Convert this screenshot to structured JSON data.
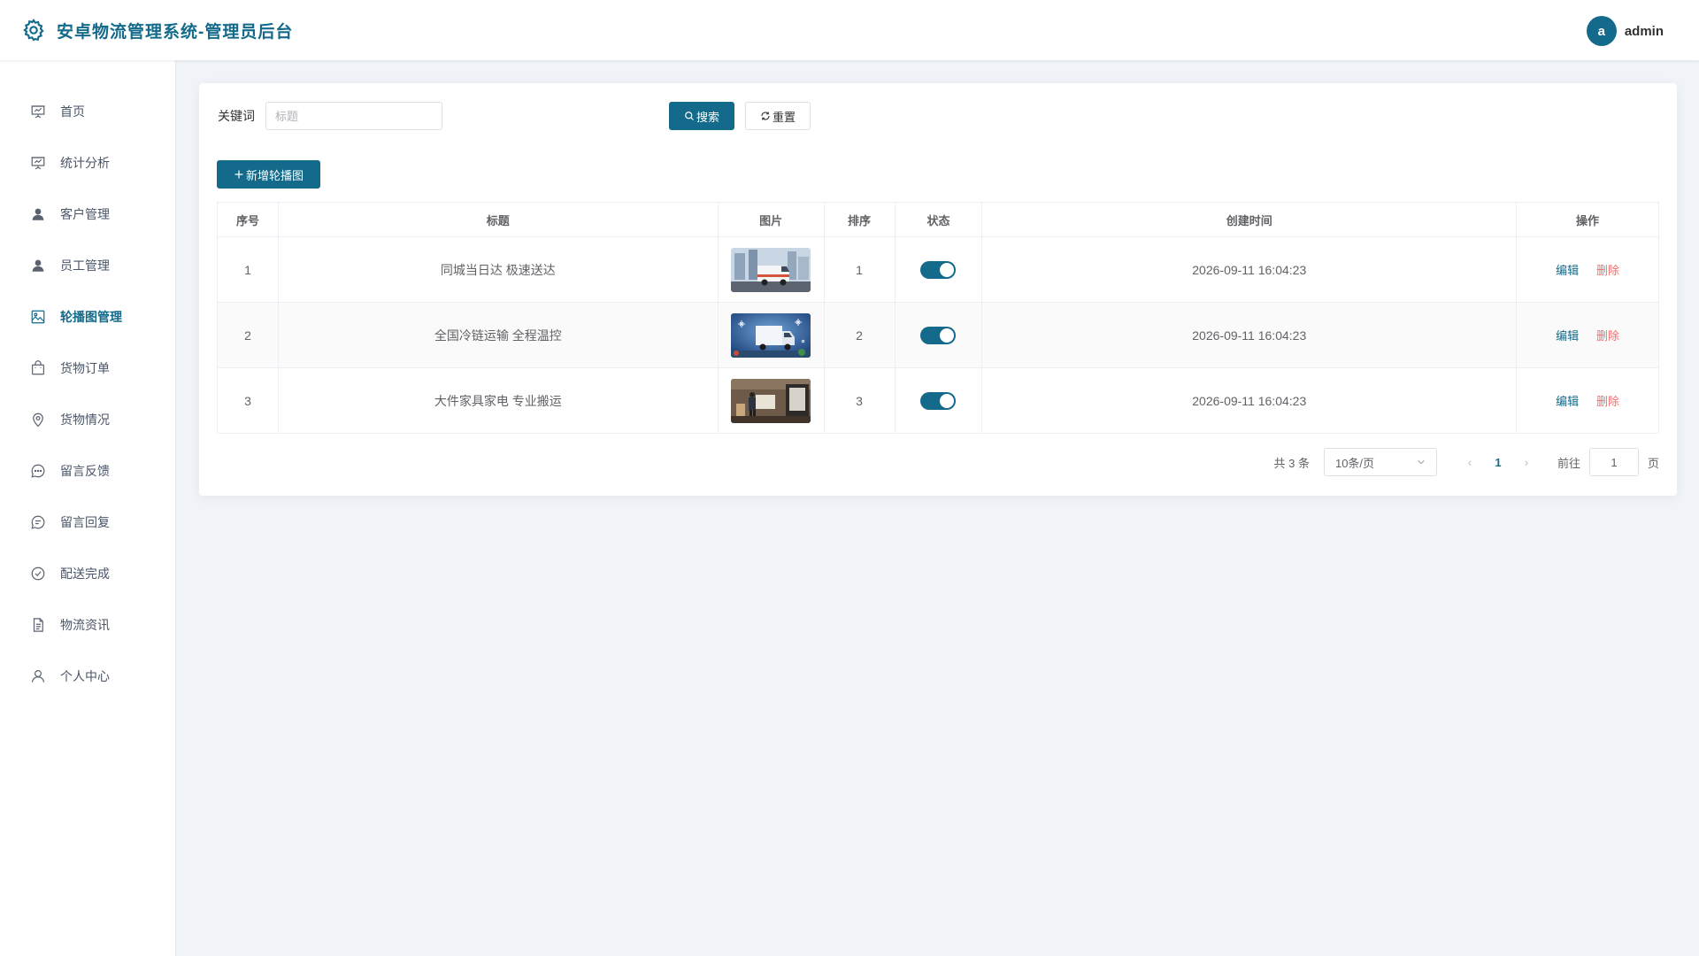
{
  "app": {
    "title": "安卓物流管理系统-管理员后台",
    "logo_icon": "gear-icon",
    "accent_color": "#136a8a"
  },
  "user": {
    "avatar_letter": "a",
    "name": "admin"
  },
  "sidebar": {
    "items": [
      {
        "label": "首页",
        "icon": "presentation-board-icon",
        "active": false
      },
      {
        "label": "统计分析",
        "icon": "presentation-board-icon",
        "active": false
      },
      {
        "label": "客户管理",
        "icon": "user-filled-icon",
        "active": false
      },
      {
        "label": "员工管理",
        "icon": "user-filled-icon",
        "active": false
      },
      {
        "label": "轮播图管理",
        "icon": "picture-icon",
        "active": true
      },
      {
        "label": "货物订单",
        "icon": "shopping-bag-icon",
        "active": false
      },
      {
        "label": "货物情况",
        "icon": "location-pin-icon",
        "active": false
      },
      {
        "label": "留言反馈",
        "icon": "chat-dots-icon",
        "active": false
      },
      {
        "label": "留言回复",
        "icon": "chat-lines-icon",
        "active": false
      },
      {
        "label": "配送完成",
        "icon": "circle-check-icon",
        "active": false
      },
      {
        "label": "物流资讯",
        "icon": "document-icon",
        "active": false
      },
      {
        "label": "个人中心",
        "icon": "user-outline-icon",
        "active": false
      }
    ]
  },
  "search": {
    "keyword_label": "关键词",
    "placeholder": "标题",
    "value": "",
    "search_label": "搜索",
    "reset_label": "重置"
  },
  "toolbar": {
    "add_label": "新增轮播图"
  },
  "table": {
    "columns": [
      "序号",
      "标题",
      "图片",
      "排序",
      "状态",
      "创建时间",
      "操作"
    ],
    "rows": [
      {
        "index": "1",
        "title": "同城当日达 极速送达",
        "image": "white-delivery-van-city-photo",
        "sort": "1",
        "enabled": true,
        "created": "2026-09-11 16:04:23"
      },
      {
        "index": "2",
        "title": "全国冷链运输 全程温控",
        "image": "refrigerated-truck-snowflake-photo",
        "sort": "2",
        "enabled": true,
        "created": "2026-09-11 16:04:23"
      },
      {
        "index": "3",
        "title": "大件家具家电 专业搬运",
        "image": "movers-carrying-furniture-photo",
        "sort": "3",
        "enabled": true,
        "created": "2026-09-11 16:04:23"
      }
    ],
    "edit_label": "编辑",
    "delete_label": "删除"
  },
  "pagination": {
    "total_text": "共 3 条",
    "page_size": "10条/页",
    "current_page": "1",
    "goto_label": "前往",
    "goto_value": "1",
    "page_suffix": "页"
  }
}
